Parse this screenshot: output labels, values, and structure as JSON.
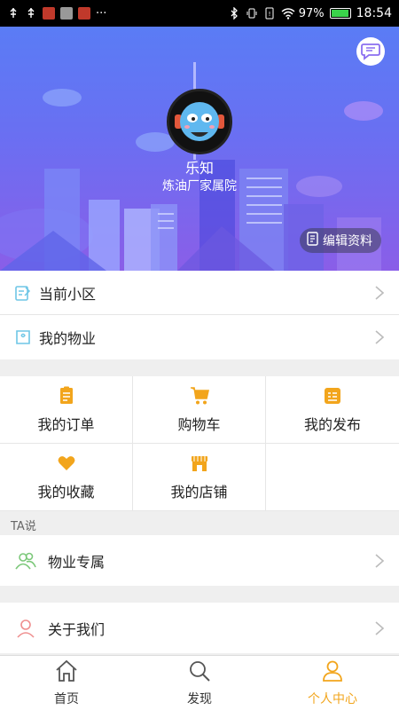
{
  "status_bar": {
    "battery": "97%",
    "battery_fraction": 0.97,
    "time": "18:54",
    "icons": [
      "usb-icon",
      "usb-icon",
      "app-notification-icon",
      "app-notification-icon",
      "app-notification-icon",
      "more-icon",
      "bluetooth-icon",
      "vibrate-icon",
      "sim-icon",
      "wifi-icon",
      "battery-icon"
    ]
  },
  "header": {
    "nickname": "乐知",
    "community": "炼油厂家属院",
    "edit_label": "编辑资料",
    "message_icon": "message-icon"
  },
  "community_rows": [
    {
      "label": "当前小区",
      "icon": "edit-note-icon"
    },
    {
      "label": "我的物业",
      "icon": "property-icon"
    }
  ],
  "grid": [
    {
      "label": "我的订单",
      "icon": "order-icon"
    },
    {
      "label": "购物车",
      "icon": "cart-icon"
    },
    {
      "label": "我的发布",
      "icon": "publish-icon"
    },
    {
      "label": "我的收藏",
      "icon": "heart-icon"
    },
    {
      "label": "我的店铺",
      "icon": "shop-icon"
    }
  ],
  "ta_section": {
    "title": "TA说",
    "row": {
      "label": "物业专属",
      "icon": "group-icon"
    }
  },
  "about_row": {
    "label": "关于我们",
    "icon": "user-icon"
  },
  "bottom_nav": [
    {
      "label": "首页",
      "icon": "home-icon",
      "active": false
    },
    {
      "label": "发现",
      "icon": "search-icon",
      "active": false
    },
    {
      "label": "个人中心",
      "icon": "profile-icon",
      "active": true
    }
  ],
  "colors": {
    "accent": "#f2a51c",
    "header_top": "#5a7cf5",
    "header_bottom": "#8a5ee8",
    "row_icon": "#6ec6e6"
  }
}
